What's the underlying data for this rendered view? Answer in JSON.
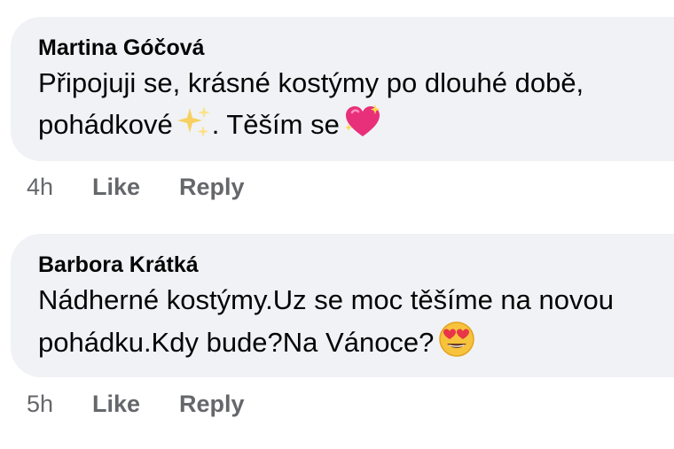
{
  "comments": [
    {
      "author": "Martina Góčová",
      "line1": "Připojuji se, krásné kostýmy po dlouhé době,",
      "line2": "pohádkové",
      "line2_after": ". Těším se",
      "emojis": [
        "sparkles-emoji",
        "sparkling-heart-emoji"
      ],
      "time": "4h",
      "like_label": "Like",
      "reply_label": "Reply"
    },
    {
      "author": "Barbora Krátká",
      "line1": "Nádherné kostýmy.Uz se moc těšíme na novou",
      "line2": "pohádku.Kdy bude?Na Vánoce?",
      "emojis": [
        "heart-eyes-emoji"
      ],
      "time": "5h",
      "like_label": "Like",
      "reply_label": "Reply"
    }
  ],
  "colors": {
    "bubble": "#f0f2f5",
    "text": "#050505",
    "meta": "#65676b"
  }
}
